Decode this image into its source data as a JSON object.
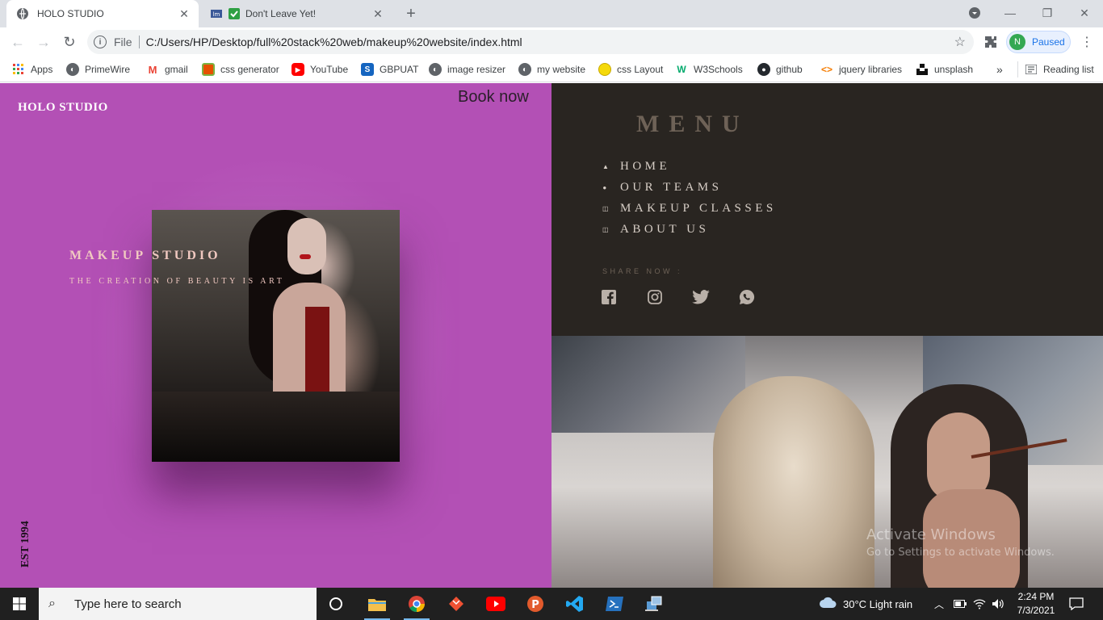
{
  "browser": {
    "tabs": [
      {
        "title": "HOLO STUDIO",
        "active": true
      },
      {
        "title": "Don't Leave Yet!",
        "active": false
      }
    ],
    "address": {
      "scheme_label": "File",
      "url": "C:/Users/HP/Desktop/full%20stack%20web/makeup%20website/index.html"
    },
    "profile": {
      "initial": "N",
      "status": "Paused"
    },
    "bookmarks": [
      {
        "label": "Apps",
        "icon": "apps-grid-icon"
      },
      {
        "label": "PrimeWire",
        "icon": "globe-icon"
      },
      {
        "label": "gmail",
        "icon": "gmail-icon"
      },
      {
        "label": "css generator",
        "icon": "css-generator-icon"
      },
      {
        "label": "YouTube",
        "icon": "youtube-icon"
      },
      {
        "label": "GBPUAT",
        "icon": "gbpuat-icon"
      },
      {
        "label": "image resizer",
        "icon": "globe-icon"
      },
      {
        "label": "my website",
        "icon": "globe-icon"
      },
      {
        "label": "css Layout",
        "icon": "css-layout-icon"
      },
      {
        "label": "W3Schools",
        "icon": "w3schools-icon"
      },
      {
        "label": "github",
        "icon": "github-icon"
      },
      {
        "label": "jquery libraries",
        "icon": "code-icon"
      },
      {
        "label": "unsplash",
        "icon": "unsplash-icon"
      }
    ],
    "bookmarks_overflow": "»",
    "reading_list": "Reading list"
  },
  "site": {
    "brand": "HOLO STUDIO",
    "book_now": "Book now",
    "hero_title": "MAKEUP STUDIO",
    "hero_subtitle": "THE CREATION OF BEAUTY IS ART",
    "est": "EST 1994",
    "menu_title": "MENU",
    "menu_items": [
      {
        "label": "HOME",
        "icon": "home-icon"
      },
      {
        "label": "OUR TEAMS",
        "icon": "person-icon"
      },
      {
        "label": "MAKEUP CLASSES",
        "icon": "book-icon"
      },
      {
        "label": "ABOUT US",
        "icon": "book-icon"
      }
    ],
    "share_label": "SHARE NOW :",
    "socials": [
      "facebook-icon",
      "instagram-icon",
      "twitter-icon",
      "whatsapp-icon"
    ],
    "colors": {
      "hero_bg": "#b350b5",
      "menu_bg": "#292521"
    }
  },
  "overlay": {
    "activate_title": "Activate Windows",
    "activate_sub": "Go to Settings to activate Windows."
  },
  "taskbar": {
    "search_placeholder": "Type here to search",
    "weather": "30°C  Light rain",
    "time": "2:24 PM",
    "date": "7/3/2021"
  }
}
